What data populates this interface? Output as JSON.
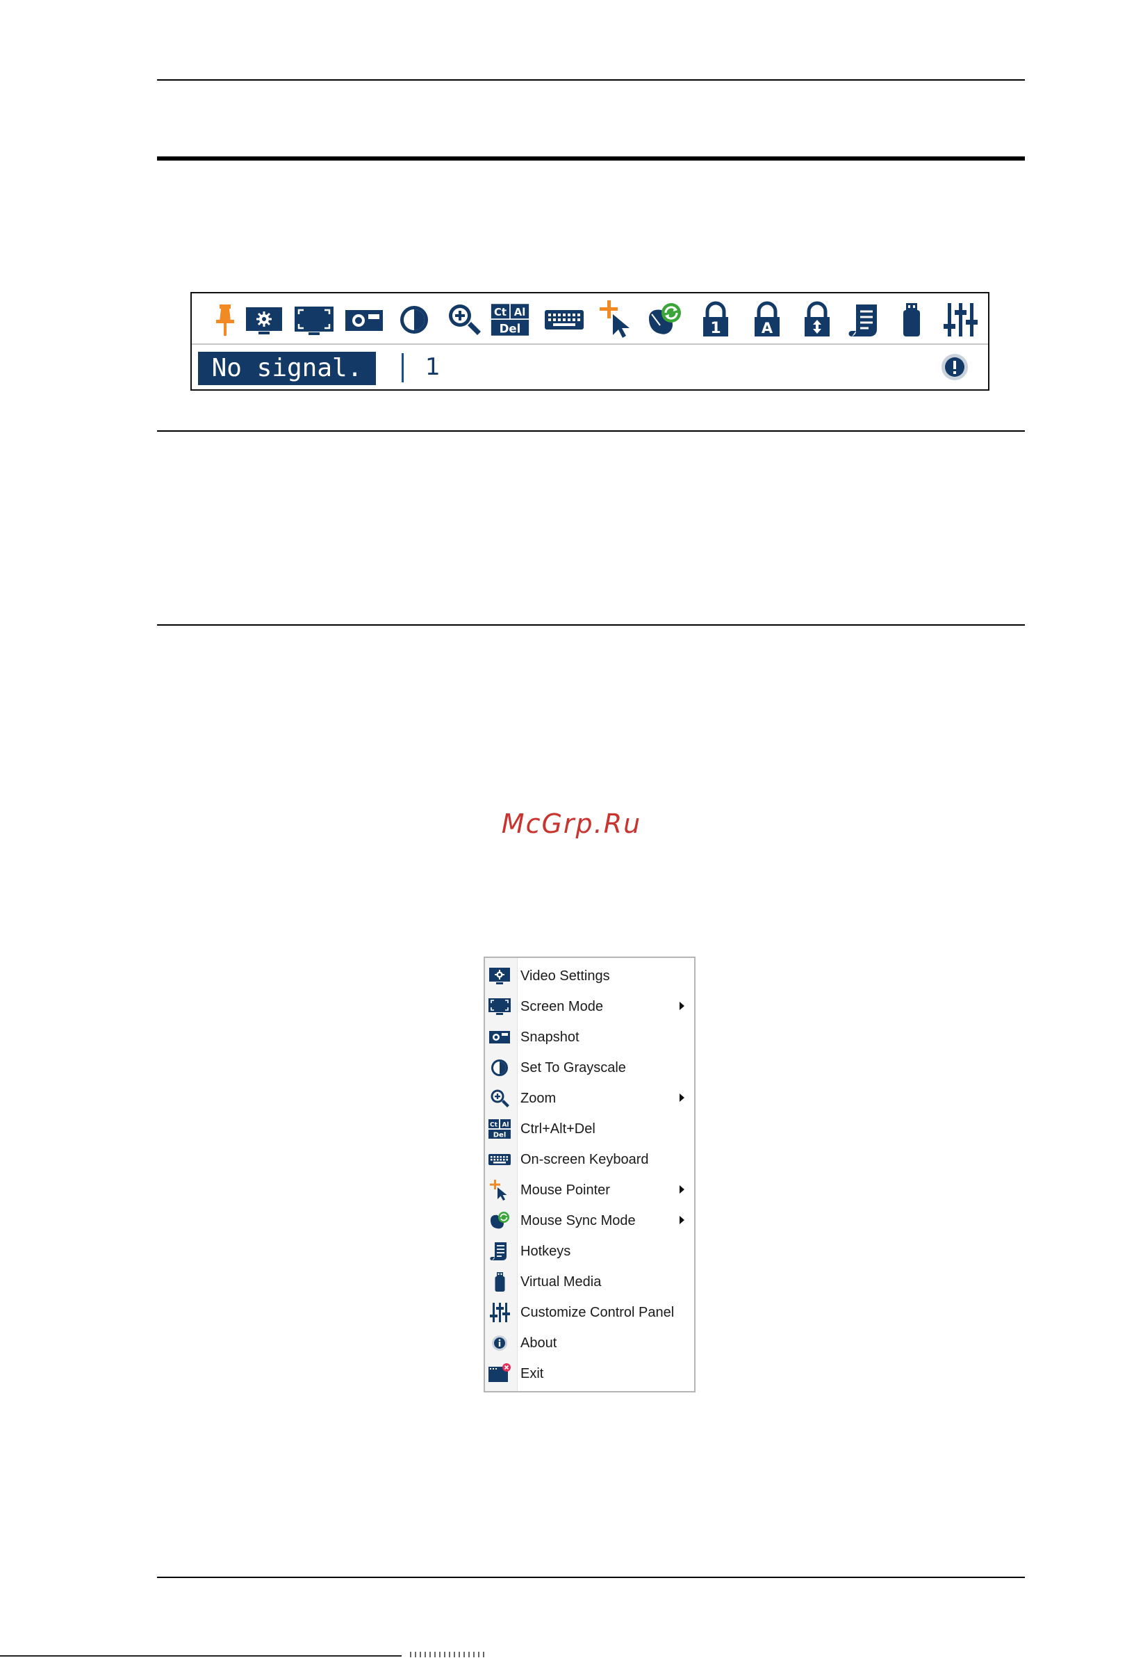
{
  "toolbar": {
    "icons": [
      "pin-icon",
      "video-settings-icon",
      "screen-mode-icon",
      "snapshot-icon",
      "grayscale-icon",
      "zoom-icon",
      "ctrl-alt-del-icon",
      "onscreen-keyboard-icon",
      "mouse-pointer-icon",
      "mouse-sync-icon",
      "lock-num-icon",
      "lock-caps-icon",
      "lock-scroll-icon",
      "hotkeys-icon",
      "virtual-media-icon",
      "customize-panel-icon"
    ],
    "ctrl_alt_del": {
      "ct": "Ct",
      "al": "Al",
      "del": "Del"
    },
    "num_lock_label": "1",
    "caps_lock_label": "A",
    "status_text": "No signal.",
    "status_number": "1"
  },
  "watermark": "McGrp.Ru",
  "menu": {
    "items": [
      {
        "label": "Video Settings",
        "icon": "video-settings-icon",
        "submenu": false
      },
      {
        "label": "Screen Mode",
        "icon": "screen-mode-icon",
        "submenu": true
      },
      {
        "label": "Snapshot",
        "icon": "snapshot-icon",
        "submenu": false
      },
      {
        "label": "Set To Grayscale",
        "icon": "grayscale-icon",
        "submenu": false
      },
      {
        "label": "Zoom",
        "icon": "zoom-icon",
        "submenu": true
      },
      {
        "label": "Ctrl+Alt+Del",
        "icon": "ctrl-alt-del-icon",
        "submenu": false
      },
      {
        "label": "On-screen Keyboard",
        "icon": "keyboard-icon",
        "submenu": false
      },
      {
        "label": "Mouse Pointer",
        "icon": "mouse-pointer-icon",
        "submenu": true
      },
      {
        "label": "Mouse Sync Mode",
        "icon": "mouse-sync-icon",
        "submenu": true
      },
      {
        "label": "Hotkeys",
        "icon": "hotkeys-icon",
        "submenu": false
      },
      {
        "label": "Virtual Media",
        "icon": "virtual-media-icon",
        "submenu": false
      },
      {
        "label": "Customize Control Panel",
        "icon": "customize-panel-icon",
        "submenu": false
      },
      {
        "label": "About",
        "icon": "info-icon",
        "submenu": false
      },
      {
        "label": "Exit",
        "icon": "exit-icon",
        "submenu": false
      }
    ]
  },
  "colors": {
    "icon_blue": "#133a66",
    "pin_orange": "#f28a24",
    "sync_green": "#3aa63a",
    "exit_red": "#e0305a"
  }
}
